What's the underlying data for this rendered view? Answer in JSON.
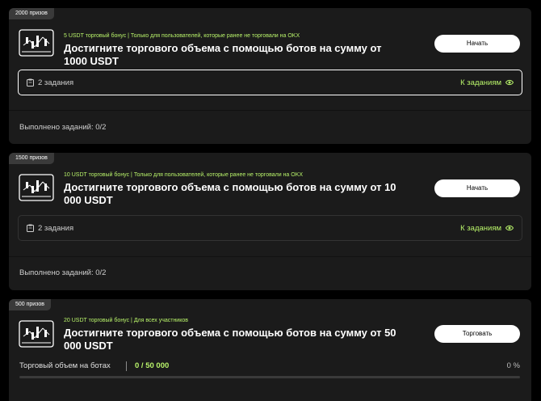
{
  "tasks": [
    {
      "prize_tag": "2000 призов",
      "bonus_text": "5 USDT торговый бонус | Только для пользователей, которые ранее не торговали на OKX",
      "title": "Достигните торгового объема с помощью ботов на сумму от 1000 USDT",
      "button_label": "Начать",
      "tasks_count": "2 задания",
      "tasks_link": "К заданиям",
      "completed": "Выполнено заданий: 0/2"
    },
    {
      "prize_tag": "1500 призов",
      "bonus_text": "10 USDT торговый бонус | Только для пользователей, которые ранее не торговали на OKX",
      "title": "Достигните торгового объема с помощью ботов на сумму от 10 000 USDT",
      "button_label": "Начать",
      "tasks_count": "2 задания",
      "tasks_link": "К заданиям",
      "completed": "Выполнено заданий: 0/2"
    },
    {
      "prize_tag": "500 призов",
      "bonus_text": "20 USDT торговый бонус | Для всех участников",
      "title": "Достигните торгового объема с помощью ботов на сумму от 50 000 USDT",
      "button_label": "Торговать",
      "volume_label": "Торговый объем на ботах",
      "volume_value": "0 / 50 000",
      "volume_percent": "0 %",
      "progress_fraction": 0
    }
  ],
  "icons": {
    "bot": "trading-bot-icon",
    "tasks": "clipboard-icon",
    "link": "eye-icon"
  },
  "colors": {
    "background": "#000000",
    "card": "#1b1b1b",
    "accent": "#b8f36a",
    "button": "#ffffff"
  }
}
